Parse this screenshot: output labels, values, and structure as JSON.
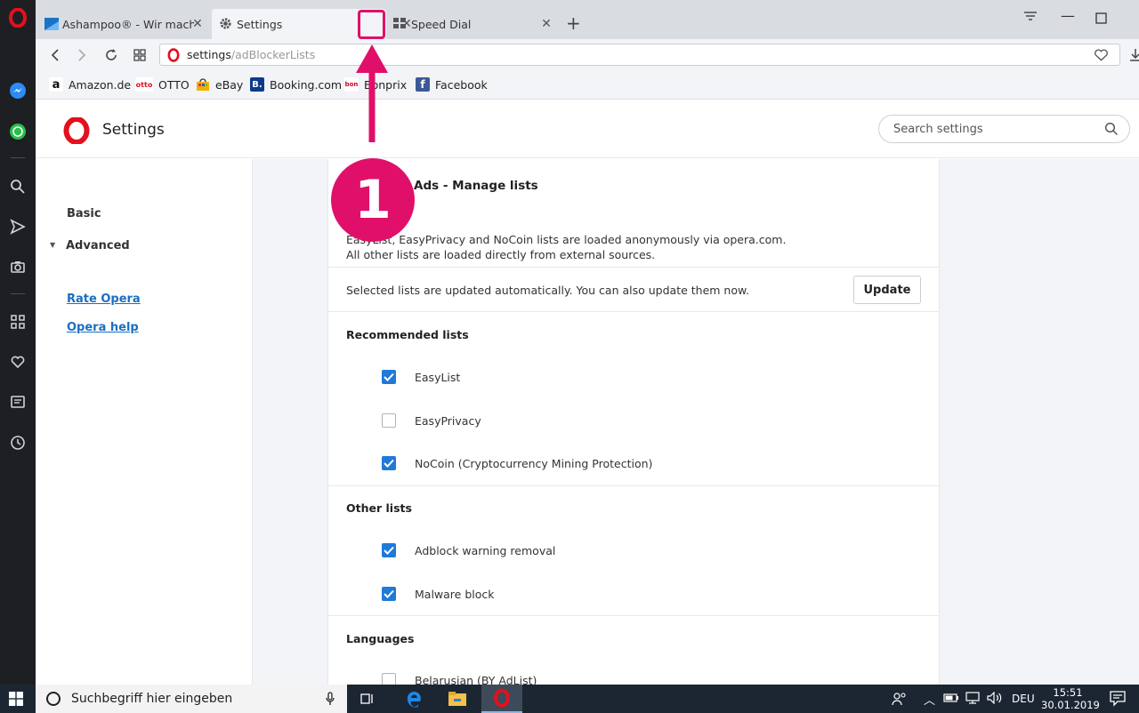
{
  "tabs": [
    {
      "label": "Ashampoo® - Wir machen",
      "favicon": "ashampoo-icon"
    },
    {
      "label": "Settings",
      "favicon": "gear-icon"
    },
    {
      "label": "Speed Dial",
      "favicon": "grid-icon"
    }
  ],
  "address": {
    "host": "settings",
    "path": "/adBlockerLists"
  },
  "bookmarks": [
    {
      "label": "Amazon.de",
      "icon_text": "a"
    },
    {
      "label": "OTTO",
      "icon_text": "otto"
    },
    {
      "label": "eBay",
      "icon_text": ""
    },
    {
      "label": "Booking.com",
      "icon_text": "B."
    },
    {
      "label": "Bonprix",
      "icon_text": "bon"
    },
    {
      "label": "Facebook",
      "icon_text": "f"
    }
  ],
  "header": {
    "title": "Settings",
    "search_placeholder": "Search settings"
  },
  "leftnav": {
    "basic": "Basic",
    "advanced": "Advanced",
    "rate": "Rate Opera",
    "help": "Opera help"
  },
  "card": {
    "title": "Ads - Manage lists",
    "desc_line1": "EasyList, EasyPrivacy and NoCoin lists are loaded anonymously via opera.com.",
    "desc_line2": "All other lists are loaded directly from external sources.",
    "update_text": "Selected lists are updated automatically. You can also update them now.",
    "update_button": "Update",
    "recommended_label": "Recommended lists",
    "recommended": [
      {
        "label": "EasyList",
        "checked": true
      },
      {
        "label": "EasyPrivacy",
        "checked": false
      },
      {
        "label": "NoCoin (Cryptocurrency Mining Protection)",
        "checked": true
      }
    ],
    "other_label": "Other lists",
    "other": [
      {
        "label": "Adblock warning removal",
        "checked": true
      },
      {
        "label": "Malware block",
        "checked": true
      }
    ],
    "languages_label": "Languages",
    "languages": [
      {
        "label": "Belarusian (BY AdList)",
        "checked": false
      }
    ]
  },
  "annotation": {
    "number": "1",
    "color": "#e0106a"
  },
  "taskbar": {
    "search_placeholder": "Suchbegriff hier eingeben",
    "lang": "DEU",
    "time": "15:51",
    "date": "30.01.2019"
  },
  "colors": {
    "accent": "#1f7ad8",
    "opera_red": "#e3101e",
    "sidebar": "#1e1f22"
  }
}
